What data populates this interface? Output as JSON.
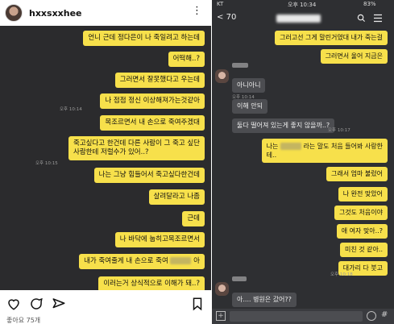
{
  "left_post": {
    "username": "hxxsxxhee",
    "more_icon": "⋮",
    "messages": [
      "언니 근데 정다은이 나 죽일려고 하는데",
      "어떡해..?",
      "그러면서 잘못했다고 우는데",
      "나 점점 정신 이상해져가는것같아",
      "목조르면서 내 손으로 죽여주겠대",
      "죽고싶다고 한건데 다른 사람이 그 죽고 싶단",
      "사람한테 저럴수가 있어..?",
      "나는 그냥 힘들어서 죽고싶다한건데",
      "살려달라고 나좀",
      "근데",
      "나 바닥에 눕히고목조르면서",
      "내가 죽여줄게 내 손으로 죽여",
      "아",
      "이러는거 상식적으로 이해가 돼..?"
    ],
    "times": [
      "오후 10:14",
      "오후 10:15"
    ],
    "likes": "좋아요 75개"
  },
  "right_chat": {
    "status": {
      "carrier": "KT",
      "time": "오후 10:34",
      "battery": "83%"
    },
    "back_count": "70",
    "my_messages_top": [
      "그러고선 그게 말린거였대 내가 죽는걸",
      "그러면서 울어 지금은"
    ],
    "their_messages": [
      "아니아니",
      "이해 안되",
      "둘다 떨어져 있는게 좋지 않을까..?"
    ],
    "my_messages_bottom": [
      "나는",
      "라는 말도 처음 들어봐 사랑한",
      "테..",
      "그래서 엄마 불렀어",
      "나 완전 맞았어",
      "그것도 처음이야",
      "애 여자 맞아..?",
      "미친 것 같아..",
      "대가리 다 붓고"
    ],
    "last_their_message": "아.... 병원은 갔어??",
    "times": [
      "오후 10:14",
      "오후 10:17",
      "오후 10:18"
    ]
  }
}
